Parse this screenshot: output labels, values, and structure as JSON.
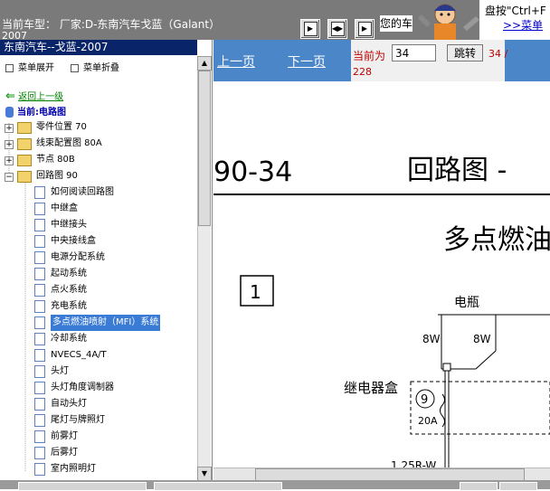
{
  "header": {
    "model_line": "当前车型： 厂家:D-东南汽车戈蓝（Galant）",
    "year": "2007",
    "nav_buttons": [
      "first-page",
      "fit",
      "last-page"
    ],
    "hint_text": "您的车",
    "help_text": "盘按\"Ctrl+F",
    "help_link": ">>菜单"
  },
  "sidebar": {
    "title": "东南汽车--戈蓝-2007",
    "menu_expand": "菜单展开",
    "menu_collapse": "菜单折叠",
    "back_link": "返回上一级",
    "current": "当前:电路图",
    "folders": [
      {
        "label": "零件位置 70",
        "state": "collapsed"
      },
      {
        "label": "线束配置图 80A",
        "state": "collapsed"
      },
      {
        "label": "节点 80B",
        "state": "collapsed"
      },
      {
        "label": "回路图 90",
        "state": "expanded"
      }
    ],
    "items": [
      "如何阅读回路图",
      "中继盒",
      "中继接头",
      "中央接线盒",
      "电源分配系统",
      "起动系统",
      "点火系统",
      "充电系统",
      "多点燃油喷射（MFI）系统",
      "冷却系统",
      "NVECS_4A/T",
      "头灯",
      "头灯角度调制器",
      "自动头灯",
      "尾灯与牌照灯",
      "前雾灯",
      "后雾灯",
      "室内照明灯"
    ],
    "selected_index": 8
  },
  "pager": {
    "prev": "上一页",
    "next": "下一页",
    "current_label": "当前为",
    "page_value": "34",
    "jump": "跳转",
    "total_a": "34 /",
    "total_b": "228"
  },
  "diagram": {
    "page_code": "90-34",
    "section_title": "回路图 - ",
    "system_title": "多点燃油",
    "box_number": "1",
    "battery_label": "电瓶",
    "wire_label_1": "8W",
    "wire_label_2": "8W",
    "relay_box_label": "继电器盒",
    "fuse_number": "9",
    "fuse_rating": "20A",
    "wire_spec": "1.25R-W"
  }
}
